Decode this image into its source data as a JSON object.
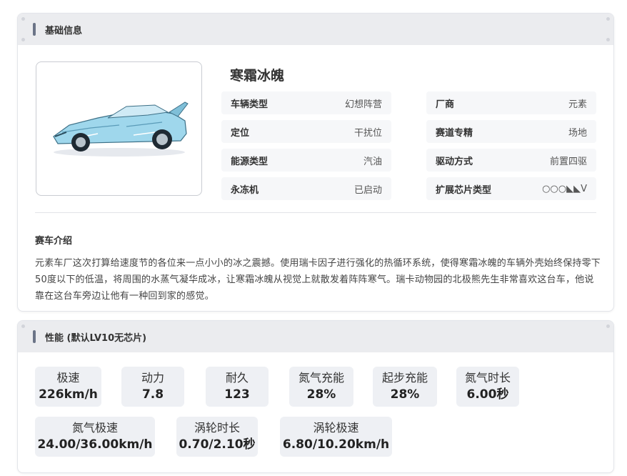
{
  "basic_info": {
    "header": "基础信息",
    "car_name": "寒霜冰魄",
    "attributes": [
      {
        "label": "车辆类型",
        "value": "幻想阵营"
      },
      {
        "label": "厂商",
        "value": "元素"
      },
      {
        "label": "定位",
        "value": "干扰位"
      },
      {
        "label": "赛道专精",
        "value": "场地"
      },
      {
        "label": "能源类型",
        "value": "汽油"
      },
      {
        "label": "驱动方式",
        "value": "前置四驱"
      },
      {
        "label": "永冻机",
        "value": "已启动"
      },
      {
        "label": "扩展芯片类型",
        "value": "○○○◣◣V"
      }
    ],
    "intro_title": "赛车介绍",
    "intro_text": "元素车厂这次打算给速度节的各位来一点小小的冰之震撼。使用瑞卡因子进行强化的热循环系统，使得寒霜冰魄的车辆外壳始终保持零下50度以下的低温，将周围的水蒸气凝华成冰，让寒霜冰魄从视觉上就散发着阵阵寒气。瑞卡动物园的北极熊先生非常喜欢这台车，他说靠在这台车旁边让他有一种回到家的感觉。"
  },
  "performance": {
    "header": "性能 (默认LV10无芯片)",
    "stats": [
      {
        "label": "极速",
        "value": "226km/h"
      },
      {
        "label": "动力",
        "value": "7.8"
      },
      {
        "label": "耐久",
        "value": "123"
      },
      {
        "label": "氮气充能",
        "value": "28%"
      },
      {
        "label": "起步充能",
        "value": "28%"
      },
      {
        "label": "氮气时长",
        "value": "6.00秒"
      },
      {
        "label": "氮气极速",
        "value": "24.00/36.00km/h"
      },
      {
        "label": "涡轮时长",
        "value": "0.70/2.10秒"
      },
      {
        "label": "涡轮极速",
        "value": "6.80/10.20km/h"
      }
    ]
  },
  "colors": {
    "header_bg": "#ebecef",
    "accent_bar": "#6b7487",
    "stat_bg": "#eef0f4",
    "car_body": "#9fd7ec"
  }
}
